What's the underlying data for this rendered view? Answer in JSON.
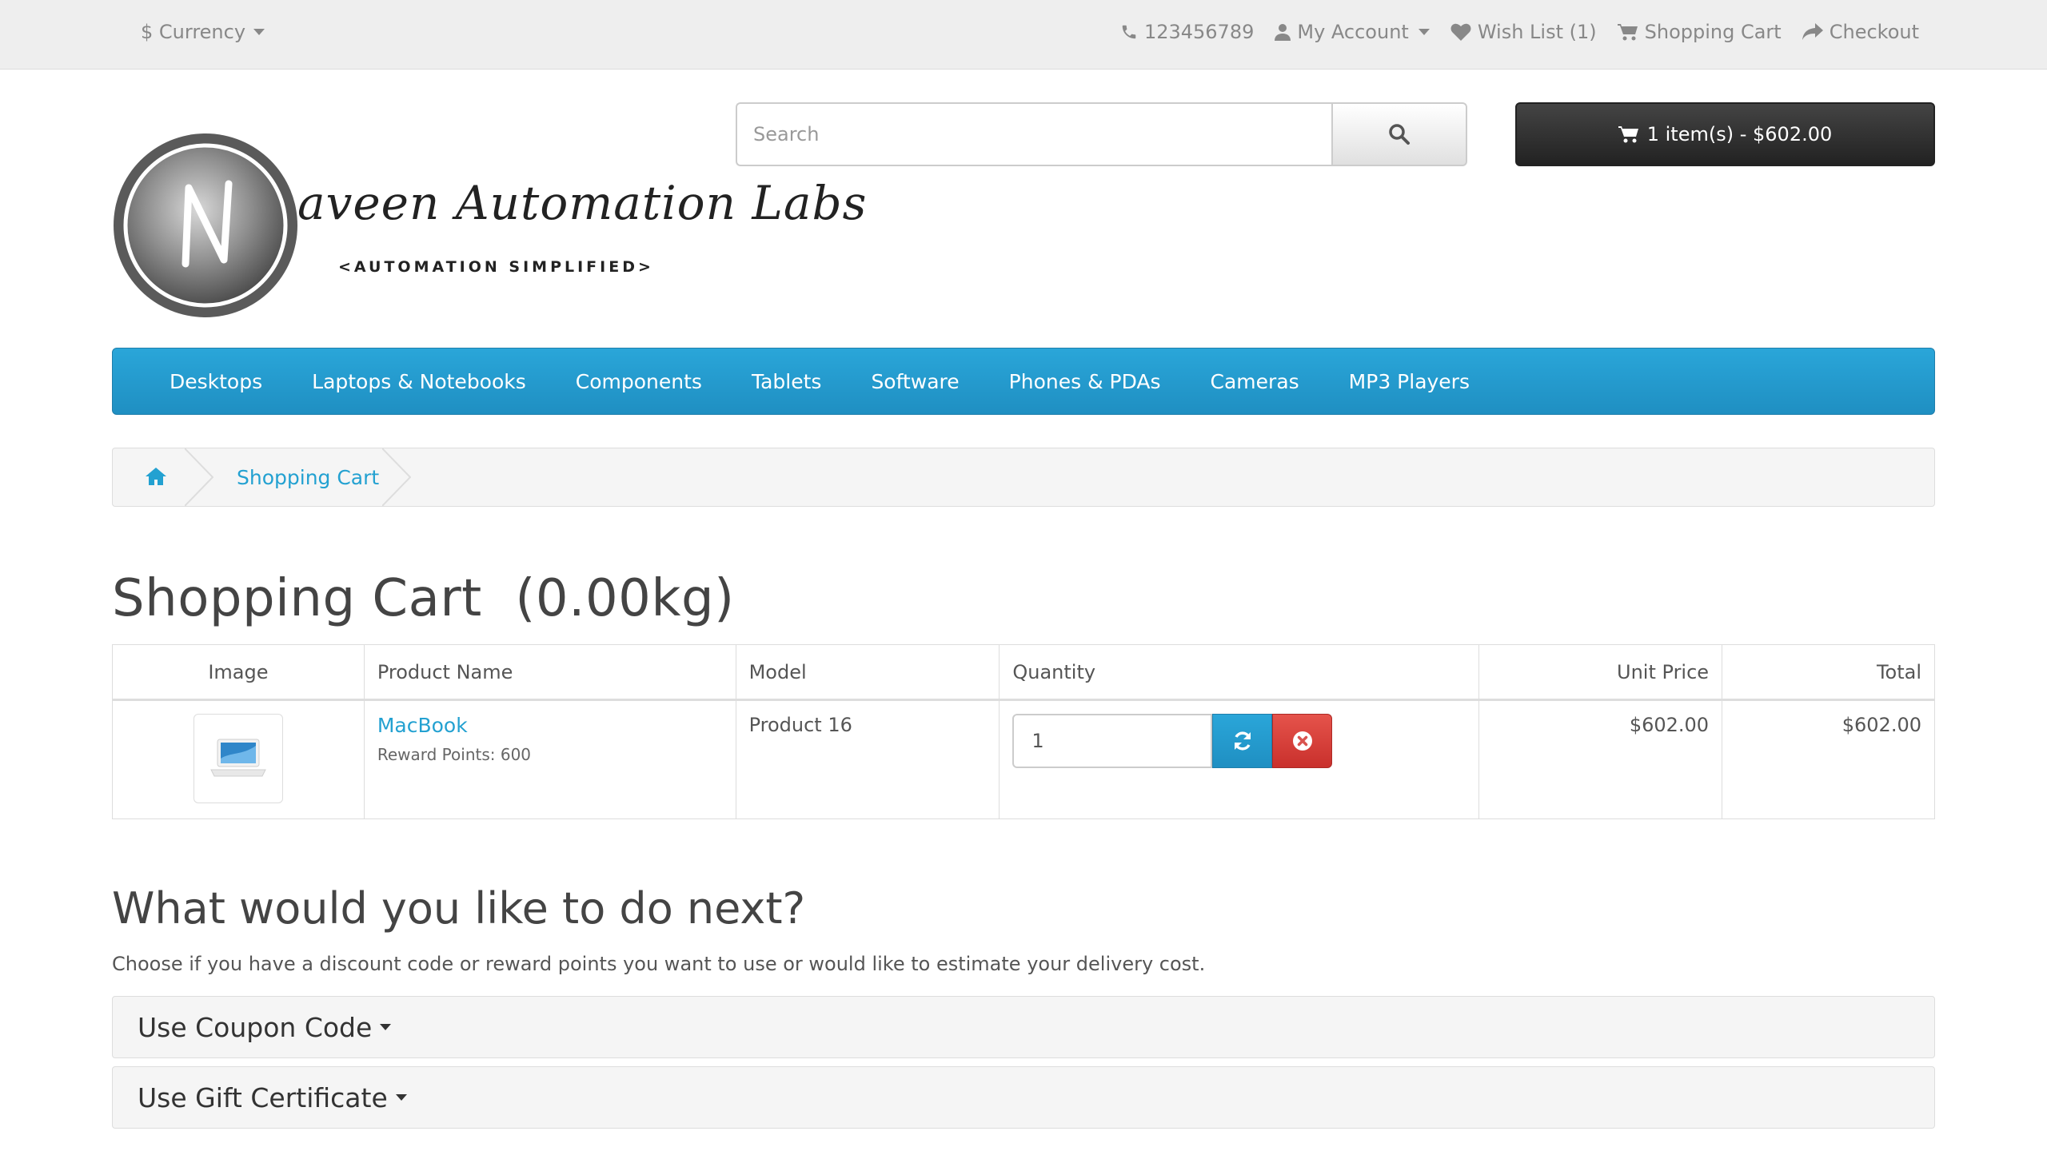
{
  "topbar": {
    "currency_label": "$ Currency",
    "phone": "123456789",
    "my_account": "My Account",
    "wish_list": "Wish List (1)",
    "shopping_cart": "Shopping Cart",
    "checkout": "Checkout"
  },
  "logo": {
    "monogram": "N",
    "script_text": "aveen Automation Labs",
    "tagline": "<AUTOMATION SIMPLIFIED>"
  },
  "search": {
    "placeholder": "Search"
  },
  "cart_button": {
    "label": "1 item(s) - $602.00"
  },
  "menu": {
    "items": [
      "Desktops",
      "Laptops & Notebooks",
      "Components",
      "Tablets",
      "Software",
      "Phones & PDAs",
      "Cameras",
      "MP3 Players"
    ]
  },
  "breadcrumb": {
    "current": "Shopping Cart"
  },
  "page": {
    "title": "Shopping Cart  (0.00kg)"
  },
  "cart_table": {
    "headers": [
      "Image",
      "Product Name",
      "Model",
      "Quantity",
      "Unit Price",
      "Total"
    ],
    "rows": [
      {
        "product_name": "MacBook",
        "reward": "Reward Points: 600",
        "model": "Product 16",
        "quantity": "1",
        "unit_price": "$602.00",
        "total": "$602.00"
      }
    ]
  },
  "next": {
    "heading": "What would you like to do next?",
    "description": "Choose if you have a discount code or reward points you want to use or would like to estimate your delivery cost.",
    "panels": [
      "Use Coupon Code",
      "Use Gift Certificate"
    ]
  },
  "colors": {
    "accent": "#229ac8",
    "link": "#23a1d1",
    "danger": "#d9534f",
    "dark_button": "#303030"
  }
}
